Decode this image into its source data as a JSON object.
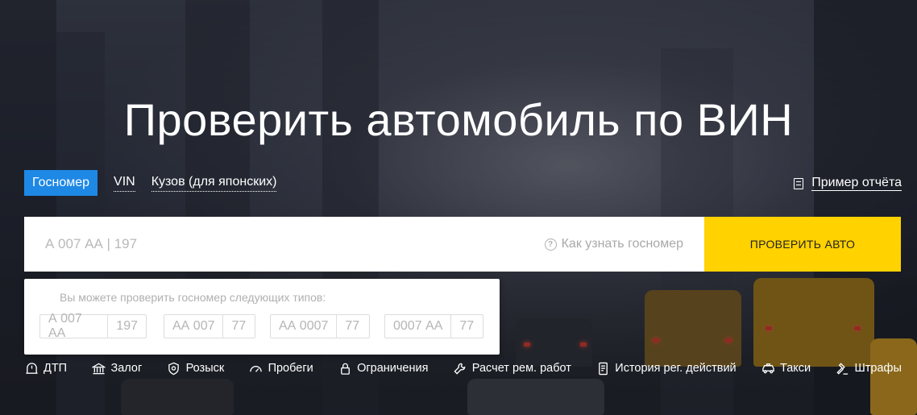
{
  "headline": "Проверить автомобиль по ВИН",
  "tabs": [
    {
      "label": "Госномер",
      "active": true
    },
    {
      "label": "VIN",
      "active": false
    },
    {
      "label": "Кузов (для японских)",
      "active": false
    }
  ],
  "sample_report": {
    "label": "Пример отчёта",
    "icon": "document-icon"
  },
  "search": {
    "placeholder": "А 007 АА | 197",
    "value": "",
    "hint": "Как узнать госномер",
    "hint_icon": "question-icon",
    "button_label": "ПРОВЕРИТЬ АВТО"
  },
  "plate_types": {
    "title": "Вы можете проверить госномер следующих типов:",
    "items": [
      {
        "number": "А 007 АА",
        "region": "197"
      },
      {
        "number": "АА 007",
        "region": "77"
      },
      {
        "number": "АА 0007",
        "region": "77"
      },
      {
        "number": "0007 АА",
        "region": "77"
      }
    ]
  },
  "features": [
    {
      "label": "ДТП",
      "icon": "accident-icon"
    },
    {
      "label": "Залог",
      "icon": "bank-icon"
    },
    {
      "label": "Розыск",
      "icon": "police-badge-icon"
    },
    {
      "label": "Пробеги",
      "icon": "speedometer-icon"
    },
    {
      "label": "Ограничения",
      "icon": "lock-icon"
    },
    {
      "label": "Расчет рем. работ",
      "icon": "wrench-icon"
    },
    {
      "label": "История рег. действий",
      "icon": "document-history-icon"
    },
    {
      "label": "Такси",
      "icon": "taxi-icon"
    },
    {
      "label": "Штрафы",
      "icon": "gavel-icon"
    }
  ],
  "colors": {
    "accent": "#1e88e5",
    "button": "#ffd200"
  }
}
